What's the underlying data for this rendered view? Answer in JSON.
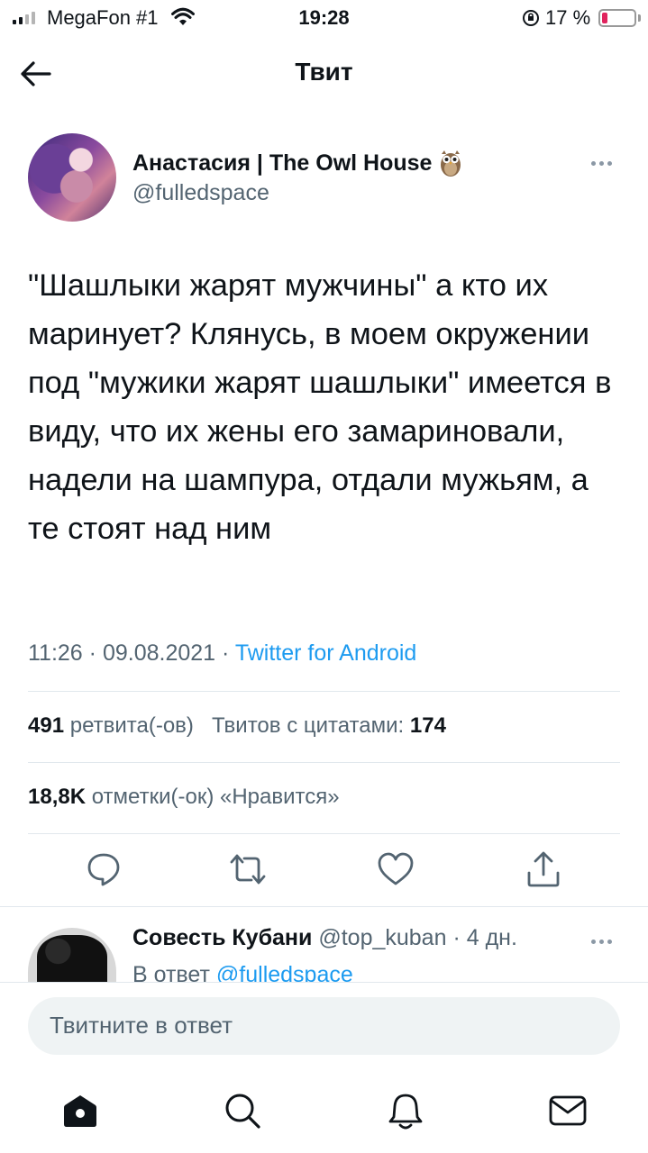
{
  "status_bar": {
    "carrier": "MegaFon #1",
    "time": "19:28",
    "battery_percent": "17 %",
    "battery_level": 0.17,
    "signal_bars": 2,
    "icons": [
      "signal-icon",
      "wifi-icon",
      "orientation-lock-icon",
      "battery-icon"
    ]
  },
  "header": {
    "title": "Твит",
    "back_icon": "arrow-left-icon"
  },
  "tweet": {
    "author_name": "Анастасия | The Owl House",
    "author_emoji_icon": "owl-icon",
    "author_handle": "@fulledspace",
    "text": "\"Шашлыки жарят мужчины\" а кто их маринует? Клянусь, в моем окружении под \"мужики жарят шашлыки\" имеется в виду, что их жены его замариновали, надели на шампура, отдали мужьям, а те стоят над ним",
    "time": "11:26",
    "separator": "·",
    "date": "09.08.2021",
    "source": "Twitter for Android",
    "retweets_count": "491",
    "retweets_label": "ретвита(-ов)",
    "quotes_label": "Твитов с цитатами:",
    "quotes_count": "174",
    "likes_count": "18,8K",
    "likes_label": "отметки(-ок) «Нравится»"
  },
  "actions": [
    "reply-icon",
    "retweet-icon",
    "like-icon",
    "share-icon"
  ],
  "reply": {
    "name": "Совесть Кубани",
    "handle": "@top_kuban",
    "separator": "·",
    "age": "4 дн.",
    "reply_to_label": "В ответ",
    "reply_to_mention": "@fulledspace"
  },
  "compose": {
    "placeholder": "Твитните в ответ"
  },
  "tabbar": [
    "home-icon",
    "search-icon",
    "notifications-icon",
    "messages-icon"
  ],
  "colors": {
    "accent": "#1d9bf0",
    "text": "#0f1419",
    "secondary": "#536471",
    "divider": "#e1e8ed",
    "battery_low": "#e0245e"
  }
}
